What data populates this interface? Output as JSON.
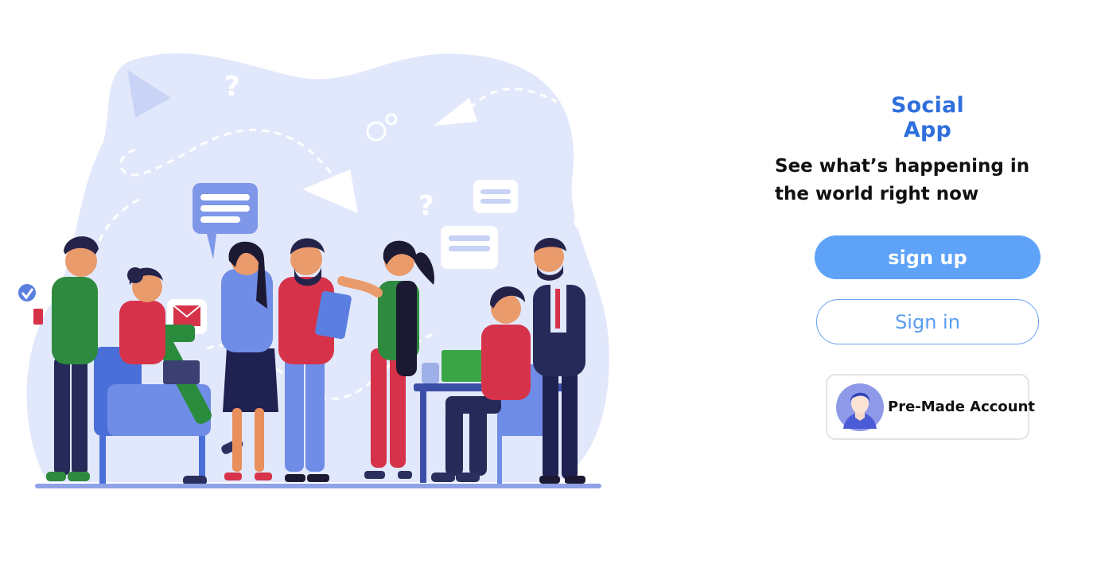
{
  "app": {
    "title": "Social App"
  },
  "hero": {
    "tagline": "See what’s happening in the world right now"
  },
  "actions": {
    "signup_label": "sign up",
    "signin_label": "Sign in",
    "premade_label": "Pre-Made Account",
    "premade_icon": "user-avatar-icon"
  },
  "colors": {
    "brand": "#2f6fdc",
    "primary_button": "#5ea3f8",
    "outline": "#6aa1f2",
    "blob": "#e2e8fb"
  }
}
